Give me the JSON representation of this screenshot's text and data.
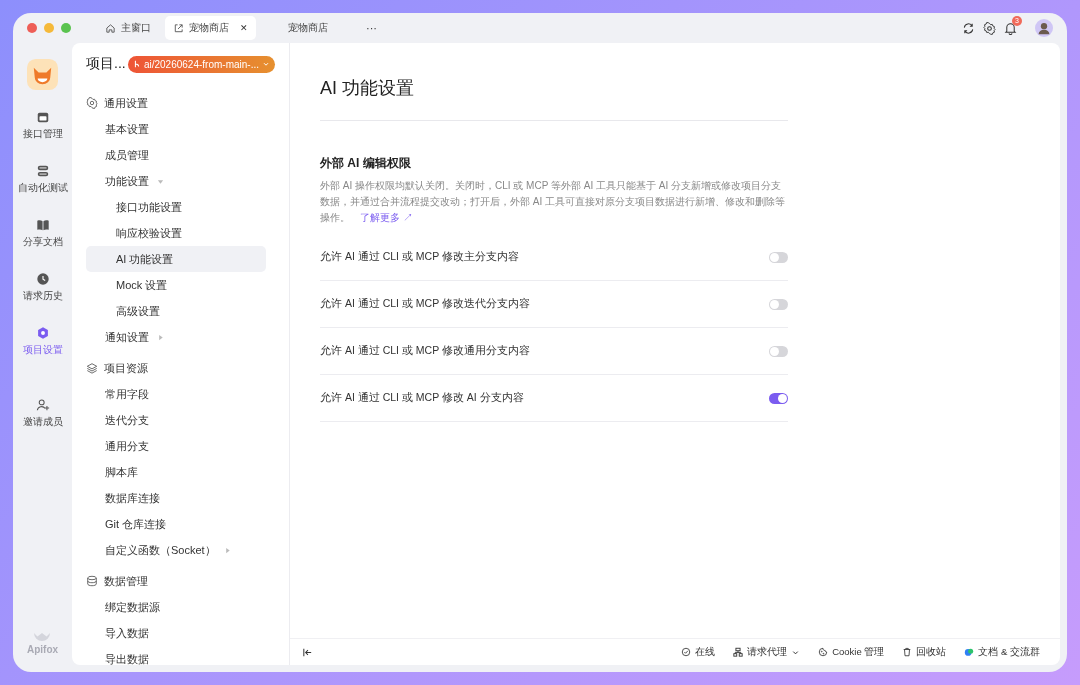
{
  "tabs": [
    {
      "label": "主窗口",
      "kind": "home",
      "selected": false
    },
    {
      "label": "宠物商店",
      "kind": "link",
      "selected": true,
      "close": "✕"
    },
    {
      "label": "宠物商店",
      "kind": "plain",
      "selected": false
    }
  ],
  "more": "···",
  "notifications": {
    "count": "3"
  },
  "rail": {
    "items": [
      {
        "label": "接口管理",
        "kind": "api",
        "selected": false
      },
      {
        "label": "自动化测试",
        "kind": "test",
        "selected": false
      },
      {
        "label": "分享文档",
        "kind": "doc",
        "selected": false
      },
      {
        "label": "请求历史",
        "kind": "history",
        "selected": false
      },
      {
        "label": "项目设置",
        "kind": "settings",
        "selected": true
      },
      {
        "label": "邀请成员",
        "kind": "invite",
        "selected": false
      }
    ],
    "brand": "Apifox"
  },
  "nav": {
    "title": "项目...",
    "branch": "ai/20260624-from-main-...",
    "groups": [
      {
        "label": "通用设置",
        "kind": "gear",
        "items": [
          {
            "label": "基本设置",
            "selected": false
          },
          {
            "label": "成员管理",
            "selected": false
          },
          {
            "label": "功能设置",
            "selected": false,
            "expanded": true,
            "children": [
              {
                "label": "接口功能设置",
                "selected": false
              },
              {
                "label": "响应校验设置",
                "selected": false
              },
              {
                "label": "AI 功能设置",
                "selected": true
              },
              {
                "label": "Mock 设置",
                "selected": false
              },
              {
                "label": "高级设置",
                "selected": false
              }
            ]
          },
          {
            "label": "通知设置",
            "selected": false,
            "expanded": false
          }
        ]
      },
      {
        "label": "项目资源",
        "kind": "layers",
        "items": [
          {
            "label": "常用字段",
            "selected": false
          },
          {
            "label": "迭代分支",
            "selected": false
          },
          {
            "label": "通用分支",
            "selected": false
          },
          {
            "label": "脚本库",
            "selected": false
          },
          {
            "label": "数据库连接",
            "selected": false
          },
          {
            "label": "Git 仓库连接",
            "selected": false
          },
          {
            "label": "自定义函数（Socket）",
            "selected": false,
            "expanded": false
          }
        ]
      },
      {
        "label": "数据管理",
        "kind": "database",
        "items": [
          {
            "label": "绑定数据源",
            "selected": false
          },
          {
            "label": "导入数据",
            "selected": false
          },
          {
            "label": "导出数据",
            "selected": false
          }
        ]
      }
    ]
  },
  "main": {
    "title": "AI 功能设置",
    "section": {
      "title": "外部 AI 编辑权限",
      "description": "外部 AI 操作权限均默认关闭。关闭时，CLI 或 MCP 等外部 AI 工具只能基于 AI 分支新增或修改项目分支数据，并通过合并流程提交改动；打开后，外部 AI 工具可直接对原分支项目数据进行新增、修改和删除等操作。",
      "link": "了解更多 ↗"
    },
    "toggles": [
      {
        "label": "允许 AI 通过 CLI 或 MCP 修改主分支内容",
        "on": false
      },
      {
        "label": "允许 AI 通过 CLI 或 MCP 修改迭代分支内容",
        "on": false
      },
      {
        "label": "允许 AI 通过 CLI 或 MCP 修改通用分支内容",
        "on": false
      },
      {
        "label": "允许 AI 通过 CLI 或 MCP 修改 AI 分支内容",
        "on": true
      }
    ]
  },
  "status_bar": [
    {
      "label": "在线",
      "kind": "online"
    },
    {
      "label": "请求代理",
      "kind": "proxy"
    },
    {
      "label": "Cookie 管理",
      "kind": "cookie"
    },
    {
      "label": "回收站",
      "kind": "trash"
    },
    {
      "label": "文档 & 交流群",
      "kind": "chat"
    }
  ]
}
